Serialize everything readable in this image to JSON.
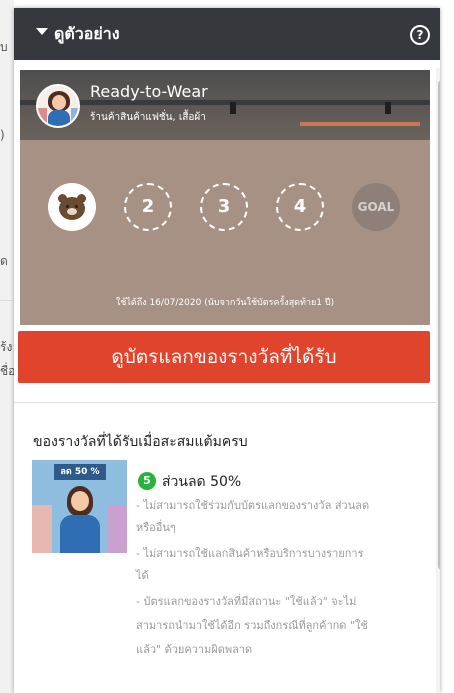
{
  "background": {
    "fragments": [
      "บ",
      ")",
      "ด",
      "ร้ง",
      "ชื่อ"
    ]
  },
  "header": {
    "title": "ดูตัวอย่าง",
    "help_symbol": "?"
  },
  "card": {
    "shop_name": "Ready-to-Wear",
    "shop_category": "ร้านค้าสินค้าแฟชั่น, เสื้อผ้า",
    "stamps": [
      "2",
      "3",
      "4"
    ],
    "goal_label": "GOAL",
    "validity": "ใช้ได้ถึง 16/07/2020 (นับจากวันใช้บัตรครั้งสุดท้าย1 ปี)"
  },
  "redeem_button_label": "ดูบัตรแลกของรางวัลที่ได้รับ",
  "rewards": {
    "section_title": "ของรางวัลที่ได้รับเมื่อสะสมแต้มครบ",
    "image_label": "ลด 50 %",
    "item": {
      "points": "5",
      "name": "ส่วนลด 50%",
      "conditions": [
        "- ไม่สามารถใช้ร่วมกับบัตรแลกของรางวัล ส่วนลด",
        "หรืออื่นๆ",
        "- ไม่สามารถใช้แลกสินค้าหรือบริการบางรายการ",
        "ได้",
        "- บัตรแลกของรางวัลที่มีสถานะ \"ใช้แล้ว\" จะไม่",
        "สามารถนำมาใช้ได้อีก รวมถึงกรณีที่ลูกค้ากด \"ใช้",
        "แล้ว\" ด้วยความผิดพลาด"
      ]
    }
  },
  "colors": {
    "header_bg": "#35393d",
    "card_bg": "#a69184",
    "button_red": "#e0442c",
    "badge_green": "#26b43c"
  }
}
